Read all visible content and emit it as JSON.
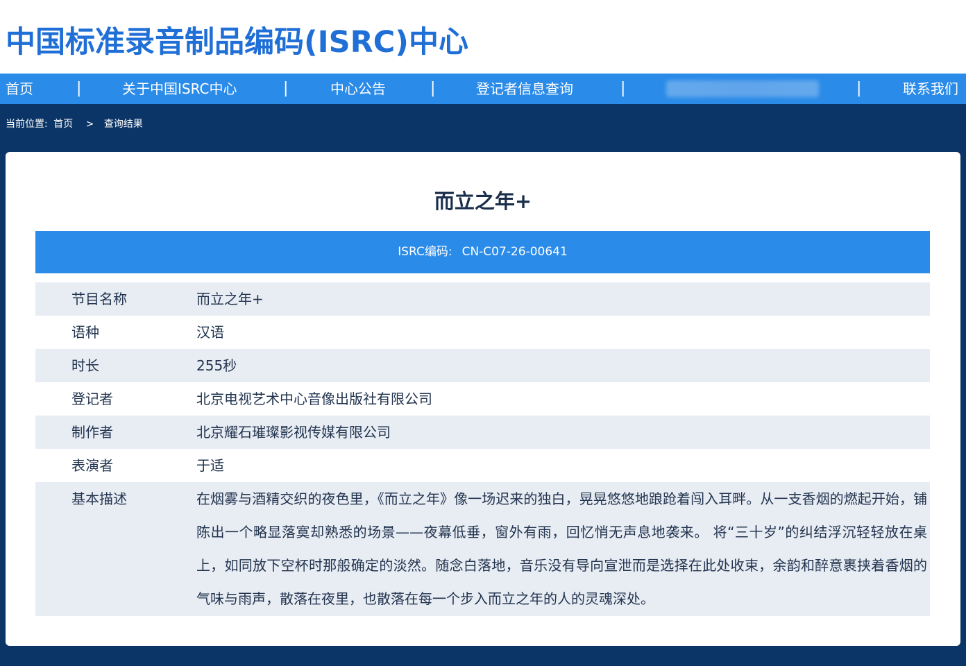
{
  "site": {
    "title": "中国标准录音制品编码(ISRC)中心"
  },
  "nav": {
    "items": [
      {
        "label": "首页"
      },
      {
        "label": "关于中国ISRC中心"
      },
      {
        "label": "中心公告"
      },
      {
        "label": "登记者信息查询"
      },
      {
        "label": "联系我们"
      }
    ],
    "separator": "|"
  },
  "breadcrumb": {
    "prefix": "当前位置:",
    "home": "首页",
    "arrow": ">",
    "current": "查询结果"
  },
  "record": {
    "title": "而立之年+",
    "isrc_label": "ISRC编码:",
    "isrc_value": "CN-C07-26-00641",
    "fields": [
      {
        "label": "节目名称",
        "value": "而立之年+"
      },
      {
        "label": "语种",
        "value": "汉语"
      },
      {
        "label": "时长",
        "value": "255秒"
      },
      {
        "label": "登记者",
        "value": "北京电视艺术中心音像出版社有限公司"
      },
      {
        "label": "制作者",
        "value": "北京耀石璀璨影视传媒有限公司"
      },
      {
        "label": "表演者",
        "value": "于适"
      },
      {
        "label": "基本描述",
        "value": "在烟雾与酒精交织的夜色里，《而立之年》像一场迟来的独白，晃晃悠悠地踉跄着闯入耳畔。从一支香烟的燃起开始，铺陈出一个略显落寞却熟悉的场景——夜幕低垂，窗外有雨，回忆悄无声息地袭来。 将“三十岁”的纠结浮沉轻轻放在桌上，如同放下空杯时那般确定的淡然。随念白落地，音乐没有导向宣泄而是选择在此处收束，余韵和醉意裹挟着香烟的气味与雨声，散落在夜里，也散落在每一个步入而立之年的人的灵魂深处。"
      }
    ]
  },
  "colors": {
    "title_blue": "#1f6fd6",
    "nav_blue": "#2b8be8",
    "page_bg": "#0b3566",
    "row_shade": "#e8ecf3"
  }
}
